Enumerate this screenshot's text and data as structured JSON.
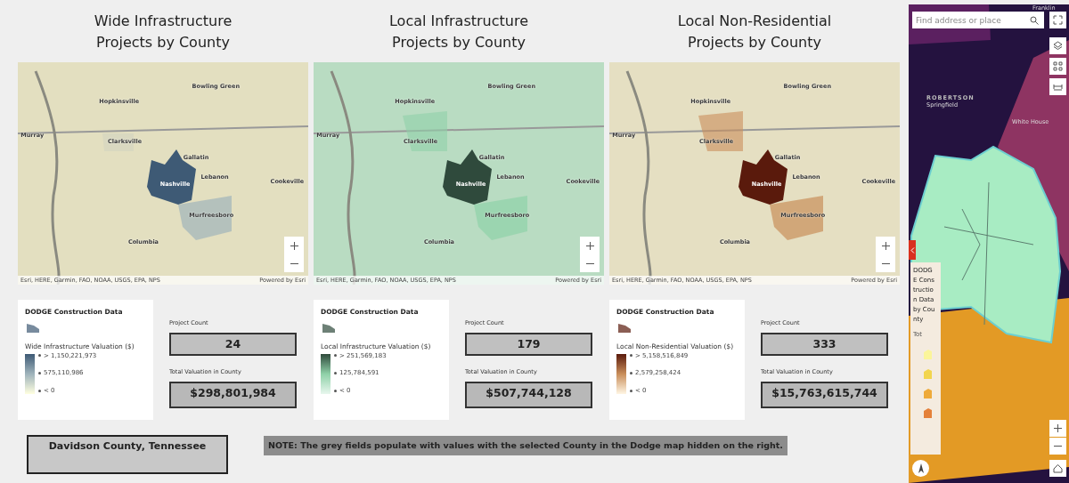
{
  "panels": [
    {
      "title": "Wide Infrastructure Projects by County",
      "color": "#3e5a75",
      "map": {
        "places": [
          "Bowling Green",
          "Hopkinsville",
          "Murray",
          "Clarksville",
          "Gallatin",
          "Lebanon",
          "Cookeville",
          "Nashville",
          "Murfreesboro",
          "Columbia"
        ],
        "attribution": "Esri, HERE, Garmin, FAO, NOAA, USGS, EPA, NPS",
        "powered_by": "Powered by Esri"
      },
      "legend": {
        "heading": "DODGE Construction Data",
        "field": "Wide Infrastructure Valuation ($)",
        "breaks": [
          "> 1,150,221,973",
          "575,110,986",
          "< 0"
        ]
      },
      "count_label": "Project Count",
      "count": "24",
      "valuation_label": "Total Valuation in County",
      "valuation": "$298,801,984"
    },
    {
      "title": "Local Infrastructure Projects by County",
      "color": "#2f4a3c",
      "map": {
        "places": [
          "Bowling Green",
          "Hopkinsville",
          "Murray",
          "Clarksville",
          "Gallatin",
          "Lebanon",
          "Cookeville",
          "Nashville",
          "Murfreesboro",
          "Columbia"
        ],
        "attribution": "Esri, HERE, Garmin, FAO, NOAA, USGS, EPA, NPS",
        "powered_by": "Powered by Esri"
      },
      "legend": {
        "heading": "DODGE Construction Data",
        "field": "Local Infrastructure Valuation ($)",
        "breaks": [
          "> 251,569,183",
          "125,784,591",
          "< 0"
        ]
      },
      "count_label": "Project Count",
      "count": "179",
      "valuation_label": "Total Valuation in County",
      "valuation": "$507,744,128"
    },
    {
      "title": "Local Non-Residential Projects by County",
      "color": "#5a1a0c",
      "map": {
        "places": [
          "Bowling Green",
          "Hopkinsville",
          "Murray",
          "Clarksville",
          "Gallatin",
          "Lebanon",
          "Cookeville",
          "Nashville",
          "Murfreesboro",
          "Columbia"
        ],
        "attribution": "Esri, HERE, Garmin, FAO, NOAA, USGS, EPA, NPS",
        "powered_by": "Powered by Esri"
      },
      "legend": {
        "heading": "DODGE Construction Data",
        "field": "Local Non-Residential Valuation ($)",
        "breaks": [
          "> 5,158,516,849",
          "2,579,258,424",
          "< 0"
        ]
      },
      "count_label": "Project Count",
      "count": "333",
      "valuation_label": "Total Valuation in County",
      "valuation": "$15,763,615,744"
    }
  ],
  "county": "Davidson County, Tennessee",
  "note": "NOTE: The grey fields populate with values with the selected County in the Dodge map hidden on the right.",
  "side_map": {
    "search": {
      "placeholder": "Find address or place"
    },
    "places": [
      "Franklin",
      "ROBERTSON",
      "Springfield",
      "White House"
    ],
    "legend": {
      "heading": "DODGE Construction Data by County",
      "field": "Tot",
      "swatches": [
        {
          "color": "#fbf59a"
        },
        {
          "color": "#f2d54e"
        },
        {
          "color": "#eeaa3a"
        },
        {
          "color": "#e4813a"
        }
      ]
    }
  }
}
